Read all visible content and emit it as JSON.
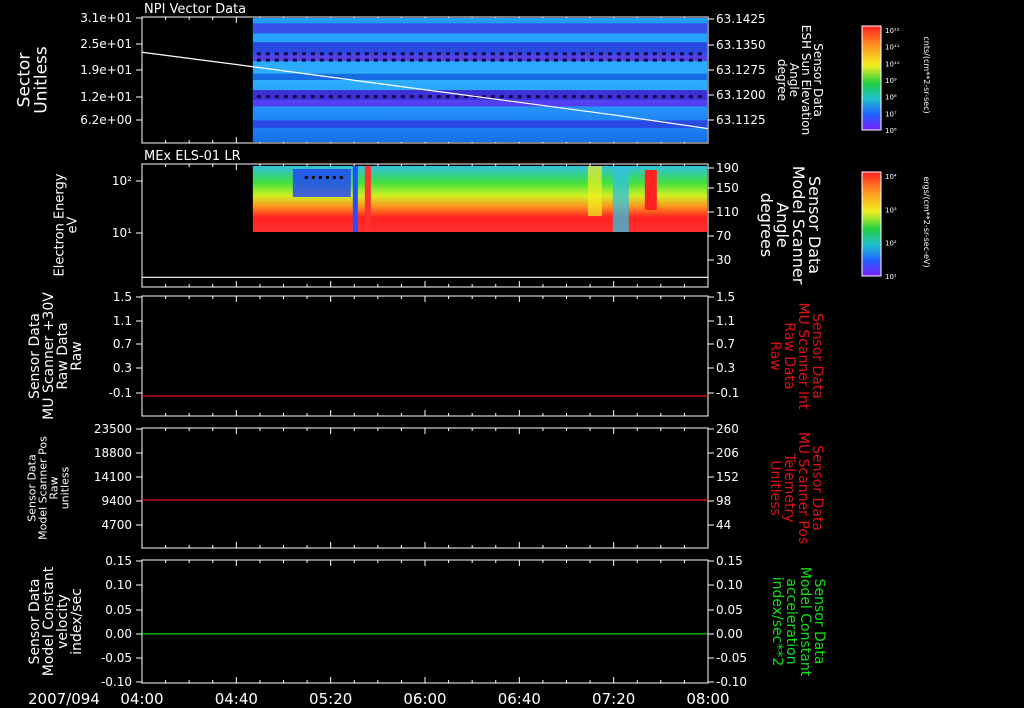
{
  "date_label": "2007/094",
  "time_ticks": [
    "04:00",
    "04:40",
    "05:20",
    "06:00",
    "06:40",
    "07:20",
    "08:00"
  ],
  "colors": {
    "white": "#ffffff",
    "red": "#e01010",
    "green": "#10e010",
    "background": "#000000"
  },
  "panels": [
    {
      "title": "NPI Vector Data",
      "left_label": [
        "Sector",
        "Unitless"
      ],
      "right_label": [
        "Sensor Data",
        "ESH Sun Elevation",
        "Angle",
        "degree"
      ],
      "right_label_color": "#ffffff",
      "left_ticks": [
        "3.1e+01",
        "2.5e+01",
        "1.9e+01",
        "1.2e+01",
        "6.2e+00"
      ],
      "right_ticks": [
        "63.1425",
        "63.1350",
        "63.1275",
        "63.1200",
        "63.1125"
      ],
      "colorbar": {
        "label": "NF",
        "unit": "cnts/(cm**2-sr-sec)",
        "ticks": [
          "10¹²",
          "10¹¹",
          "10¹⁰",
          "10⁹",
          "10⁸",
          "10⁷",
          "10⁶"
        ]
      }
    },
    {
      "title": "MEx ELS-01 LR",
      "left_label": [
        "Electron Energy",
        "eV"
      ],
      "right_label": [
        "Sensor Data",
        "Model Scanner",
        "Angle",
        "degrees"
      ],
      "right_label_color": "#ffffff",
      "left_ticks": [
        "10²",
        "10¹"
      ],
      "right_ticks": [
        "190",
        "150",
        "110",
        "70",
        "30"
      ],
      "colorbar": {
        "label": "DEF",
        "unit": "ergs/(cm**2-sr-sec-eV)",
        "ticks": [
          "10⁴",
          "10³",
          "10²",
          "10¹"
        ]
      }
    },
    {
      "left_label": [
        "Sensor Data",
        "MU Scanner +30V",
        "Raw Data",
        "Raw"
      ],
      "right_label": [
        "Sensor Data",
        "MU Scanner Int",
        "Raw Data",
        "Raw"
      ],
      "right_label_color": "#e01010",
      "left_ticks": [
        "1.5",
        "1.1",
        "0.7",
        "0.3",
        "-0.1"
      ],
      "right_ticks": [
        "1.5",
        "1.1",
        "0.7",
        "0.3",
        "-0.1"
      ]
    },
    {
      "left_label": [
        "Sensor Data",
        "Model Scanner Pos",
        "Raw",
        "unitless"
      ],
      "right_label": [
        "Sensor Data",
        "MU Scanner Pos",
        "Telemetry",
        "Unitless"
      ],
      "right_label_color": "#e01010",
      "left_ticks": [
        "23500",
        "18800",
        "14100",
        "9400",
        "4700"
      ],
      "right_ticks": [
        "260",
        "206",
        "152",
        "98",
        "44"
      ]
    },
    {
      "left_label": [
        "Sensor Data",
        "Model Constant",
        "velocity",
        "index/sec"
      ],
      "right_label": [
        "Sensor Data",
        "Model Constant",
        "acceleration",
        "index/sec**2"
      ],
      "right_label_color": "#10e010",
      "left_ticks": [
        "0.15",
        "0.10",
        "0.05",
        "0.00",
        "-0.05",
        "-0.10"
      ],
      "right_ticks": [
        "0.15",
        "0.10",
        "0.05",
        "0.00",
        "-0.05",
        "-0.10"
      ]
    }
  ],
  "chart_data": [
    {
      "type": "heatmap",
      "title": "NPI Vector Data",
      "x_range": [
        "04:00",
        "08:00"
      ],
      "data_start": "04:47",
      "ylabel": "Sector Unitless",
      "ylim": [
        0,
        31
      ],
      "overlay_line": {
        "label": "Sensor Data ESH Sun Elevation Angle degree",
        "x": [
          "04:00",
          "04:40",
          "05:20",
          "06:00",
          "06:40",
          "07:20",
          "08:00"
        ],
        "y": [
          63.1352,
          63.1318,
          63.1283,
          63.1248,
          63.1213,
          63.1178,
          63.114
        ],
        "ylim": [
          63.11,
          63.145
        ],
        "color": "#ffffff"
      }
    },
    {
      "type": "heatmap",
      "title": "MEx ELS-01 LR",
      "x_range": [
        "04:00",
        "08:00"
      ],
      "data_start": "04:47",
      "ylabel": "Electron Energy eV",
      "y_scale": "log",
      "ylim": [
        1,
        200
      ],
      "overlay_line": {
        "label": "Sensor Data Model Scanner Angle degrees",
        "x": [
          "04:00",
          "08:00"
        ],
        "y": [
          15,
          15
        ],
        "ylim": [
          0,
          190
        ],
        "color": "#ffffff"
      }
    },
    {
      "type": "line",
      "x": [
        "04:00",
        "08:00"
      ],
      "series": [
        {
          "name": "Sensor Data MU Scanner Int Raw Data Raw",
          "values": [
            0,
            0
          ],
          "color": "#e01010"
        }
      ],
      "ylim": [
        -0.3,
        1.5
      ]
    },
    {
      "type": "line",
      "x": [
        "04:00",
        "08:00"
      ],
      "series": [
        {
          "name": "Sensor Data MU Scanner Pos Telemetry Unitless",
          "values": [
            9400,
            9400
          ],
          "color": "#e01010"
        }
      ],
      "ylim": [
        0,
        23500
      ]
    },
    {
      "type": "line",
      "x": [
        "04:00",
        "08:00"
      ],
      "series": [
        {
          "name": "Sensor Data Model Constant acceleration index/sec**2",
          "values": [
            0,
            0
          ],
          "color": "#10e010"
        }
      ],
      "ylim": [
        -0.1,
        0.15
      ]
    }
  ]
}
